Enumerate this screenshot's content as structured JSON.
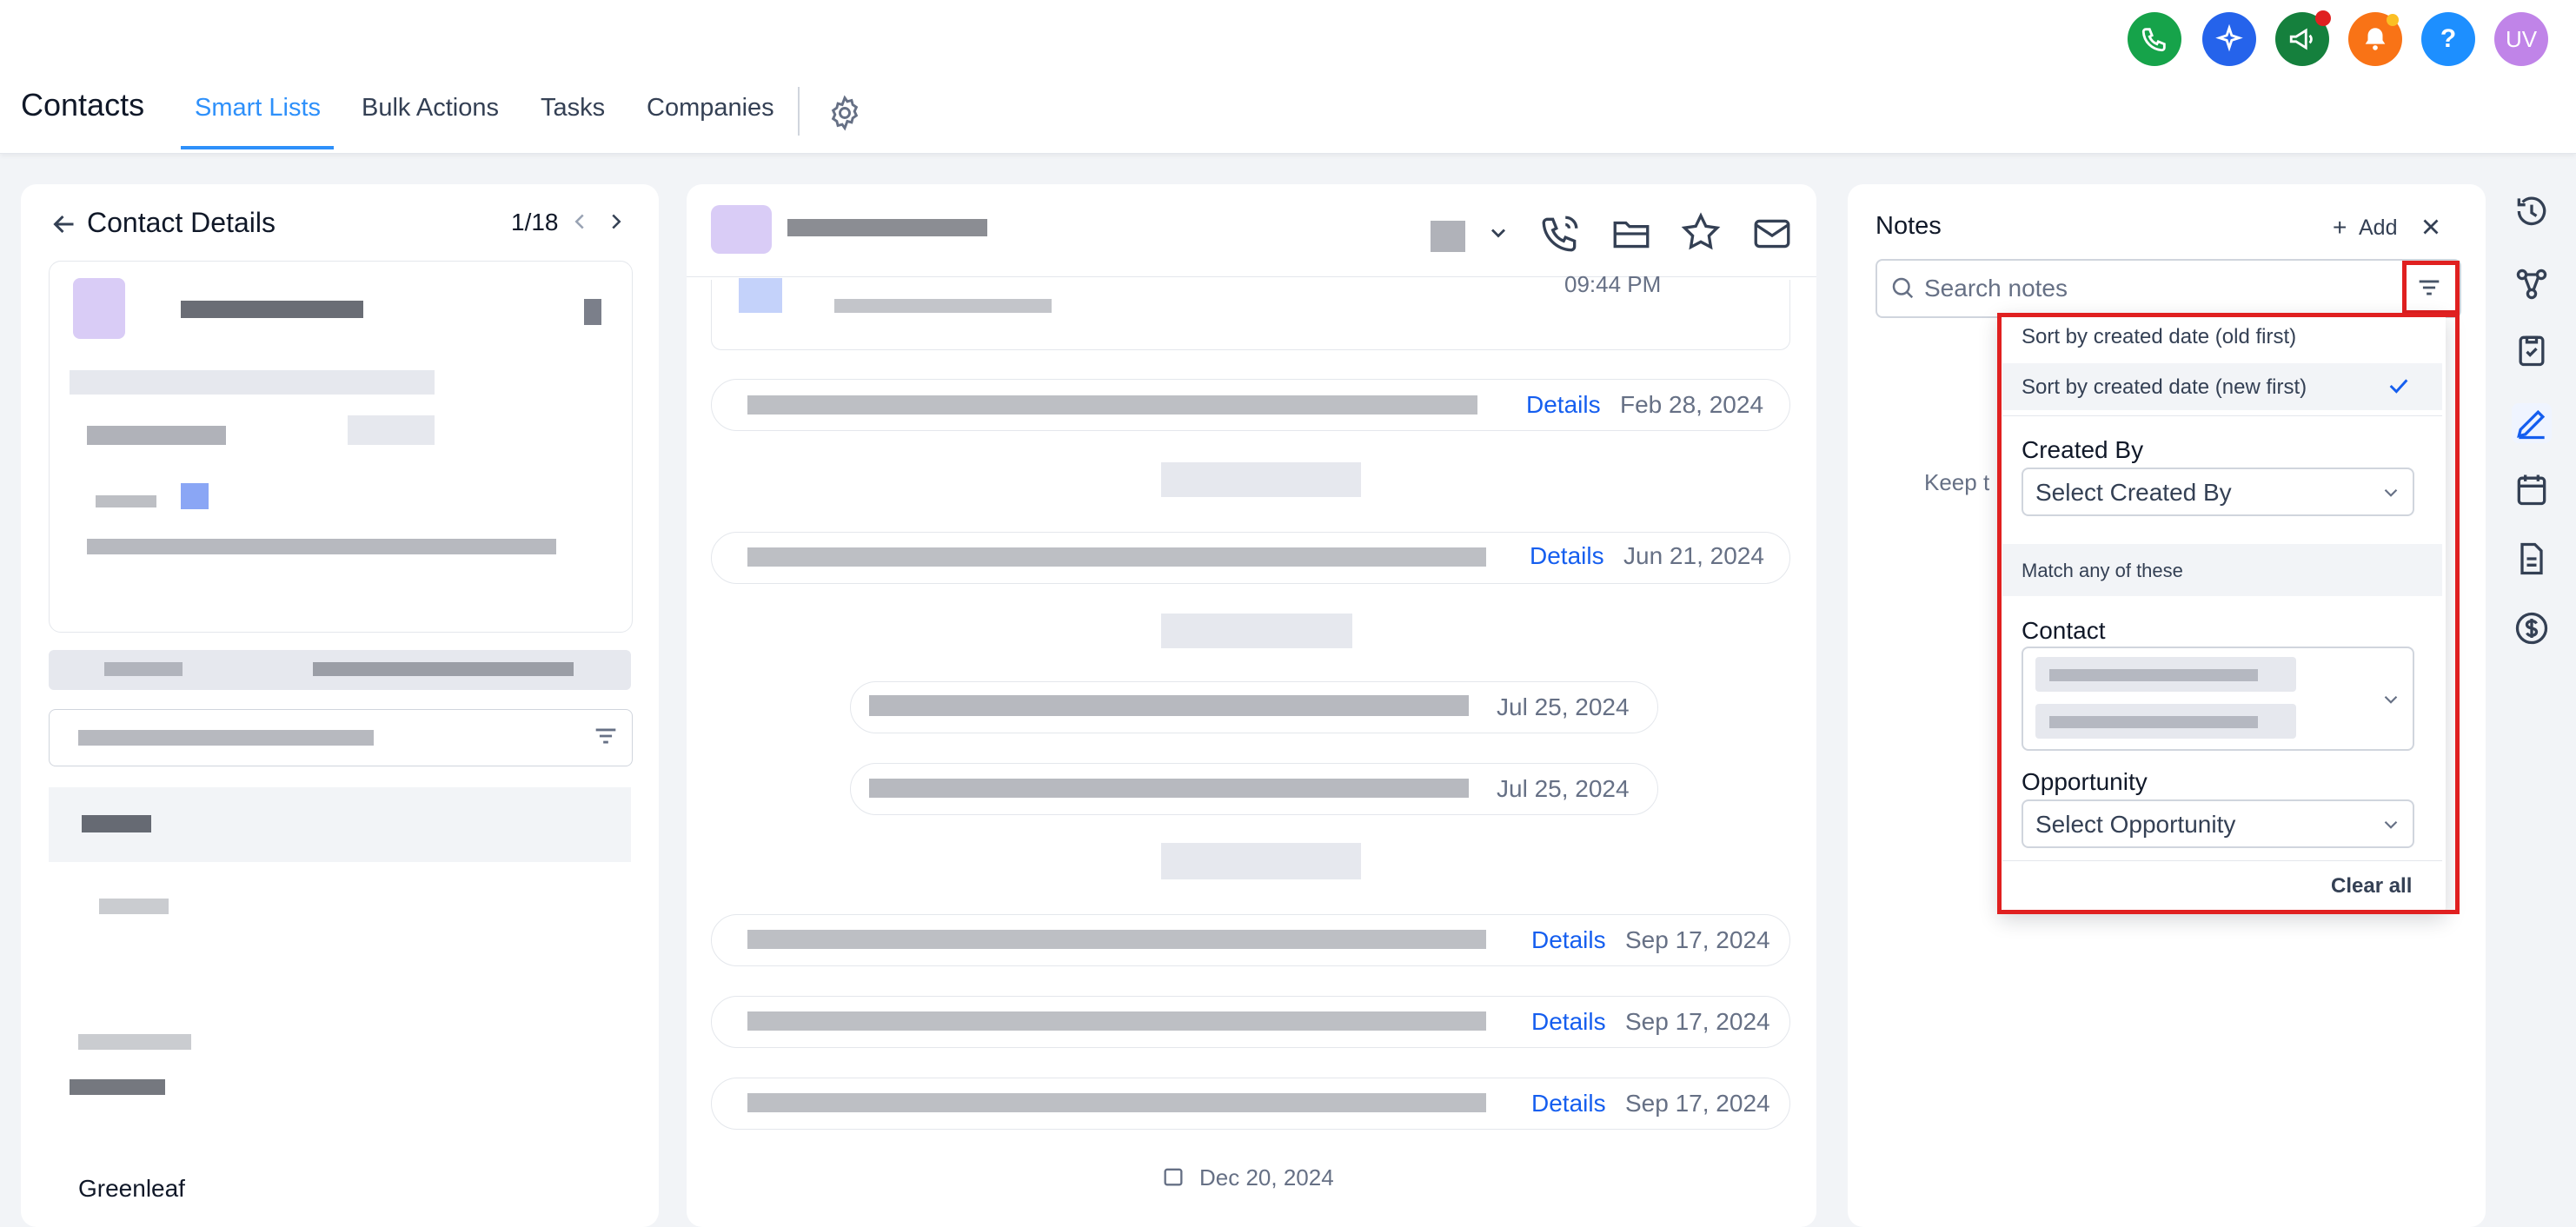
{
  "header": {
    "title": "Contacts",
    "tabs": [
      {
        "label": "Smart Lists",
        "active": true
      },
      {
        "label": "Bulk Actions",
        "active": false
      },
      {
        "label": "Tasks",
        "active": false
      },
      {
        "label": "Companies",
        "active": false
      }
    ],
    "avatar_initials": "UV",
    "help_glyph": "?"
  },
  "left_panel": {
    "title": "Contact Details",
    "pager": "1/18",
    "bottom_text": "Greenleaf"
  },
  "conversation": {
    "top_time": "09:44 PM",
    "rows": [
      {
        "link": "Details",
        "date": "Feb 28, 2024"
      },
      {
        "link": "Details",
        "date": "Jun 21, 2024"
      },
      {
        "link": "",
        "date": "Jul 25, 2024"
      },
      {
        "link": "",
        "date": "Jul 25, 2024"
      },
      {
        "link": "Details",
        "date": "Sep 17, 2024"
      },
      {
        "link": "Details",
        "date": "Sep 17, 2024"
      },
      {
        "link": "Details",
        "date": "Sep 17, 2024"
      }
    ],
    "bottom_date": "Dec 20, 2024"
  },
  "notes": {
    "title": "Notes",
    "add_label": "Add",
    "search_placeholder": "Search notes",
    "empty_hint": "Keep t",
    "filter": {
      "sort_old": "Sort by created date (old first)",
      "sort_new": "Sort by created date (new first)",
      "created_by_label": "Created By",
      "created_by_value": "Select Created By",
      "match_label": "Match any of these",
      "contact_label": "Contact",
      "opportunity_label": "Opportunity",
      "opportunity_value": "Select Opportunity",
      "clear_all": "Clear all"
    }
  },
  "colors": {
    "accent": "#2e90fa",
    "link": "#155eef",
    "highlight_box": "#e02020",
    "phone_icon": "#16a34a",
    "ai_icon": "#2563eb",
    "megaphone_icon": "#15803d",
    "bell_icon": "#f97316",
    "help_icon": "#1d8fff",
    "avatar": "#c084e8"
  }
}
